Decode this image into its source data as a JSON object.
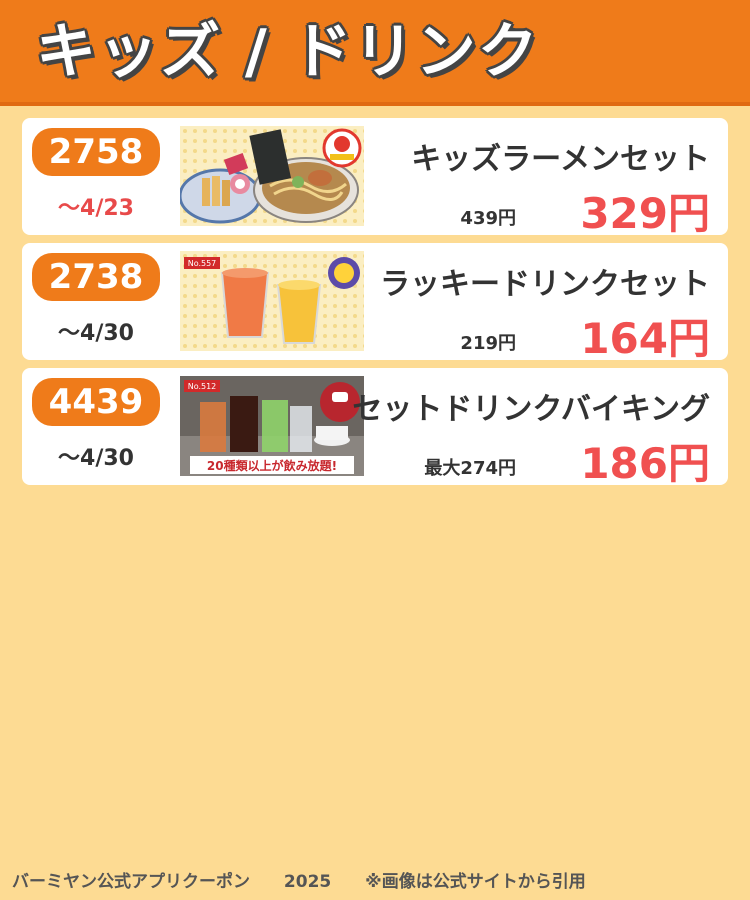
{
  "header": {
    "title": "キッズ / ドリンク"
  },
  "coupons": [
    {
      "code": "2758",
      "expiry": "〜4/23",
      "expiry_color": "#e84a4a",
      "name": "キッズラーメンセット",
      "original_price": "439円",
      "sale_price": "329円",
      "image": {
        "badge_text": ""
      }
    },
    {
      "code": "2738",
      "expiry": "〜4/30",
      "expiry_color": "#333333",
      "name": "ラッキードリンクセット",
      "original_price": "219円",
      "sale_price": "164円",
      "image": {
        "badge_text": "No.557"
      }
    },
    {
      "code": "4439",
      "expiry": "〜4/30",
      "expiry_color": "#333333",
      "name": "セットドリンクバイキング",
      "original_price": "最大274円",
      "sale_price": "186円",
      "image": {
        "badge_text": "No.512",
        "banner_text": "20種類以上が飲み放題!"
      }
    }
  ],
  "footer": {
    "source": "バーミヤン公式アプリクーポン",
    "year": "2025",
    "note": "※画像は公式サイトから引用"
  },
  "colors": {
    "header_bg": "#ef7b1a",
    "page_bg": "#fddb93",
    "sale_price": "#f05050",
    "badge_bg": "#ef7b1a"
  }
}
